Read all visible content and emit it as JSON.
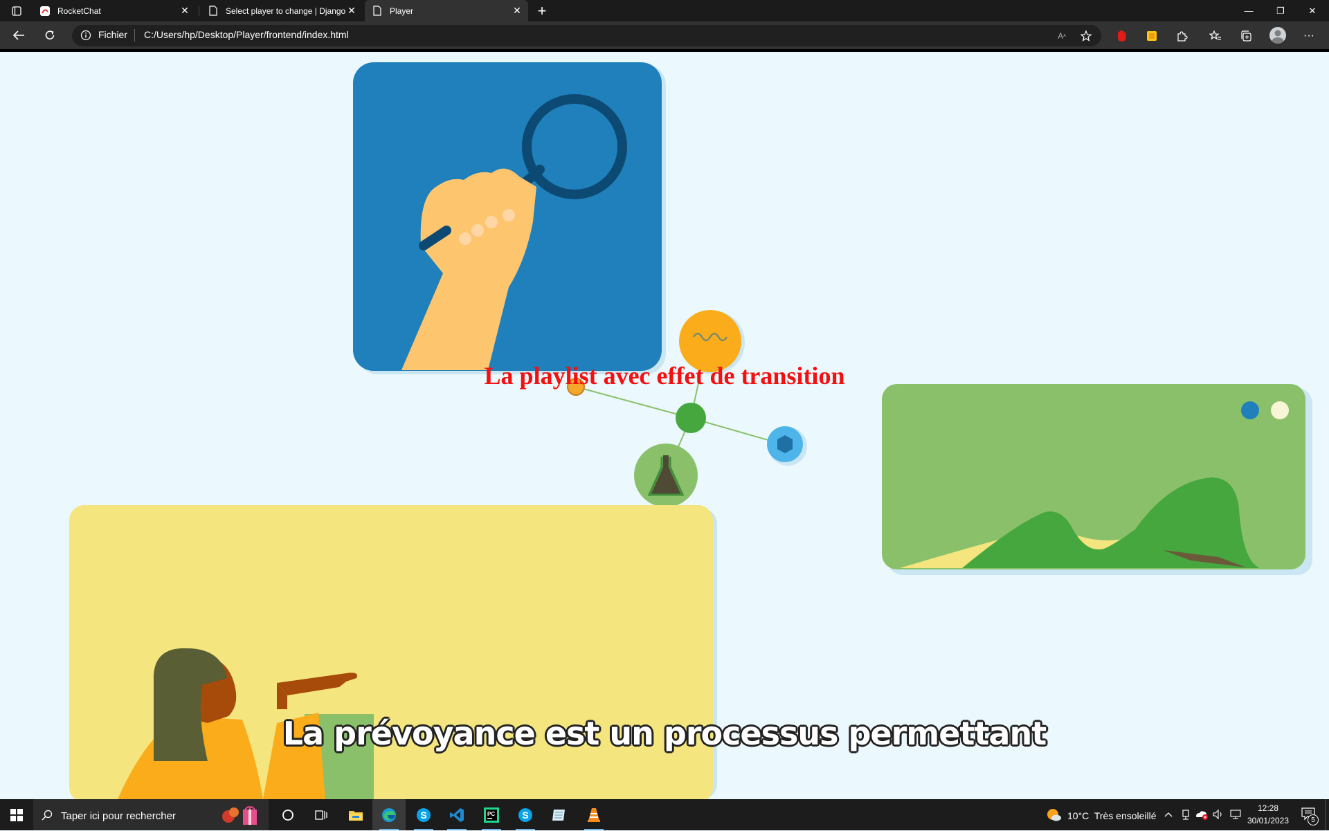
{
  "browser": {
    "tabs": [
      {
        "label": "RocketChat",
        "close": "✕"
      },
      {
        "label": "Select player to change | Django",
        "close": "✕"
      },
      {
        "label": "Player",
        "close": "✕"
      }
    ],
    "new_tab": "+",
    "address": {
      "scheme_label": "Fichier",
      "url": "C:/Users/hp/Desktop/Player/frontend/index.html"
    },
    "window_controls": {
      "minimize": "—",
      "restore": "❐",
      "close": "✕"
    },
    "more": "···"
  },
  "page": {
    "title": "La playlist avec effet de transition",
    "subtitle": "La prévoyance est un processus permettant"
  },
  "taskbar": {
    "search_placeholder": "Taper ici pour rechercher",
    "weather": "10°C  Très ensoleillé",
    "time": "12:28",
    "date": "30/01/2023",
    "notification_count": "5"
  },
  "colors": {
    "title": "#f50f0f",
    "illustration_blue": "#1f80bb",
    "illustration_green": "#8bc06b",
    "illustration_yellow": "#f4e57e",
    "accent_orange": "#fbac1b"
  }
}
